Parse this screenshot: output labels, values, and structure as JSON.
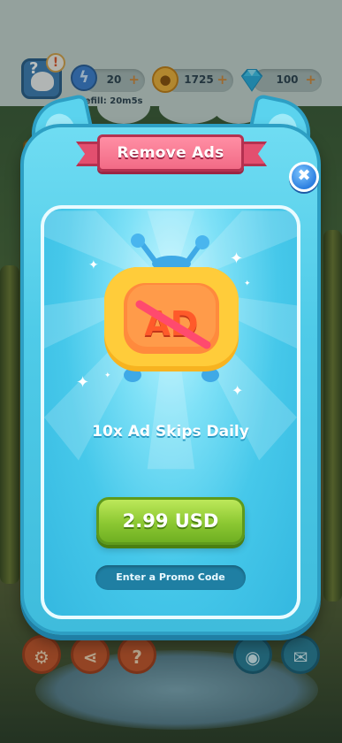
{
  "status_bar": {
    "energy_value": "20",
    "coins_value": "1725",
    "gems_value": "100",
    "plus_label": "+",
    "refill_text": "Refill: 20m5s",
    "alert_mark": "!",
    "avatar_mark": "?"
  },
  "modal": {
    "title": "Remove Ads",
    "close_glyph": "✖",
    "tv_label": "AD",
    "subtitle": "10x Ad Skips Daily",
    "buy_label": "2.99 USD",
    "promo_label": "Enter a Promo Code"
  },
  "bottom_bar": {
    "settings_icon": "gear-icon",
    "share_icon": "share-icon",
    "help_glyph": "?",
    "discord_icon": "discord-icon",
    "mail_icon": "mail-icon"
  },
  "colors": {
    "modal_frame": "#4fcbe8",
    "ribbon": "#f26b86",
    "buy_button": "#8cc832",
    "promo_button": "#1f7fa3",
    "tv_body": "#f7b320"
  }
}
